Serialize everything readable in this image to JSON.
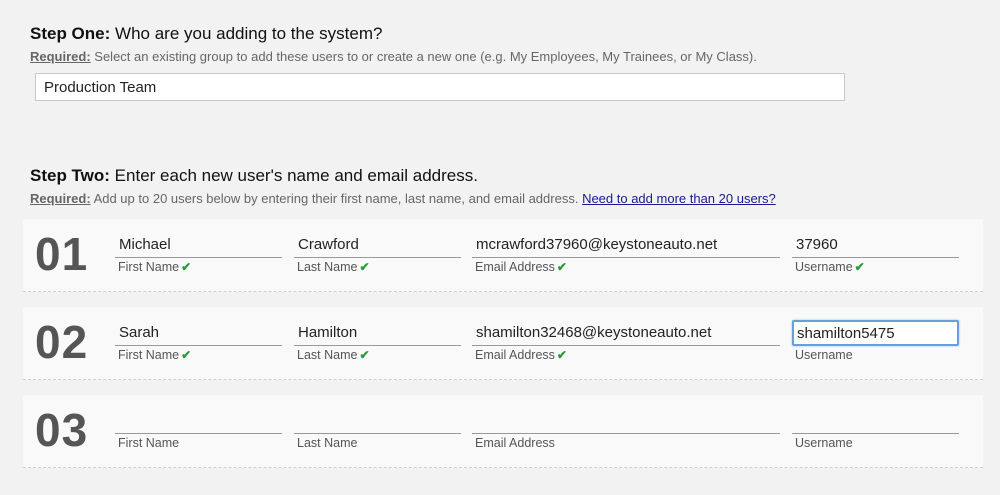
{
  "step_one": {
    "heading": "Step One:",
    "title": " Who are you adding to the system?",
    "required_label": "Required:",
    "description": " Select an existing group to add these users to or create a new one (e.g. My Employees, My Trainees, or My Class).",
    "group_value": "Production Team"
  },
  "step_two": {
    "heading": "Step Two:",
    "title": " Enter each new user's name and email address.",
    "required_label": "Required:",
    "description": " Add up to 20 users below by entering their first name, last name, and email address. ",
    "more_link": "Need to add more than 20 users?"
  },
  "labels": {
    "first_name": "First Name",
    "last_name": "Last Name",
    "email": "Email Address",
    "username": "Username"
  },
  "check_glyph": "✔",
  "colors": {
    "check": "#2a9a3a",
    "link": "#1a1a8c",
    "focus": "#6b9ddc"
  },
  "rows": [
    {
      "number": "01",
      "first_name": "Michael",
      "last_name": "Crawford",
      "email": "mcrawford37960@keystoneauto.net",
      "username": "37960"
    },
    {
      "number": "02",
      "first_name": "Sarah",
      "last_name": "Hamilton",
      "email": "shamilton32468@keystoneauto.net",
      "username": "shamilton5475"
    },
    {
      "number": "03",
      "first_name": "",
      "last_name": "",
      "email": "",
      "username": ""
    }
  ]
}
